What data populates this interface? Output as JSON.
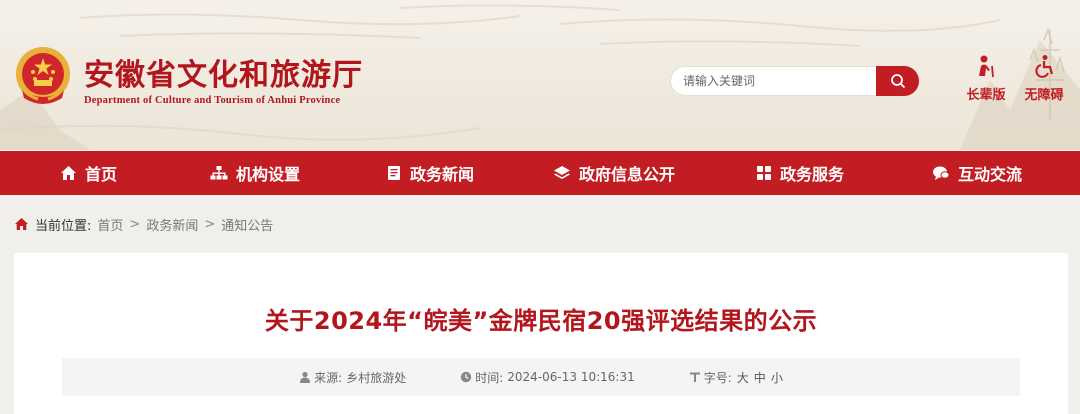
{
  "header": {
    "title_cn": "安徽省文化和旅游厅",
    "title_en": "Department of Culture and Tourism of Anhui Province",
    "search_placeholder": "请输入关键词",
    "tools": [
      {
        "label": "长辈版",
        "icon": "elder-icon"
      },
      {
        "label": "无障碍",
        "icon": "accessibility-icon"
      }
    ],
    "accent_color": "#c21d23"
  },
  "nav": {
    "items": [
      {
        "label": "首页",
        "icon": "home-icon"
      },
      {
        "label": "机构设置",
        "icon": "org-icon"
      },
      {
        "label": "政务新闻",
        "icon": "news-icon"
      },
      {
        "label": "政府信息公开",
        "icon": "layers-icon"
      },
      {
        "label": "政务服务",
        "icon": "grid-icon"
      },
      {
        "label": "互动交流",
        "icon": "chat-icon"
      }
    ]
  },
  "breadcrumb": {
    "label": "当前位置:",
    "items": [
      "首页",
      "政务新闻",
      "通知公告"
    ],
    "separator": ">"
  },
  "article": {
    "title": "关于2024年“皖美”金牌民宿20强评选结果的公示",
    "source_label": "来源:",
    "source": "乡村旅游处",
    "time_label": "时间:",
    "time": "2024-06-13 10:16:31",
    "fontsize_label": "字号:",
    "fontsizes": [
      "大",
      "中",
      "小"
    ]
  }
}
